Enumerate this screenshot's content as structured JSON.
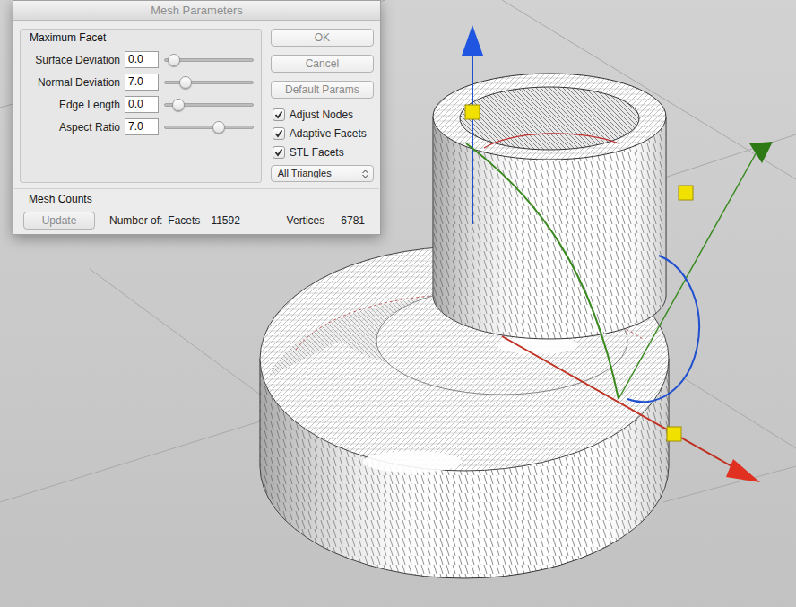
{
  "window": {
    "title": "Mesh Parameters"
  },
  "facet_group": {
    "title": "Maximum Facet",
    "params": [
      {
        "label": "Surface Deviation",
        "value": "0.0",
        "level": 0.05
      },
      {
        "label": "Normal Deviation",
        "value": "7.0",
        "level": 0.2
      },
      {
        "label": "Edge Length",
        "value": "0.0",
        "level": 0.1
      },
      {
        "label": "Aspect Ratio",
        "value": "7.0",
        "level": 0.63
      }
    ]
  },
  "buttons": [
    "OK",
    "Cancel",
    "Default Params"
  ],
  "options": [
    {
      "label": "Adjust Nodes",
      "checked": true
    },
    {
      "label": "Adaptive Facets",
      "checked": true
    },
    {
      "label": "STL Facets",
      "checked": true
    }
  ],
  "facet_type": {
    "value": "All Triangles"
  },
  "counts": {
    "title": "Mesh Counts",
    "update_button": "Update",
    "number_of": "Number of:",
    "facets_label": "Facets",
    "facets": "11592",
    "vertices_label": "Vertices",
    "vertices": "6781"
  }
}
